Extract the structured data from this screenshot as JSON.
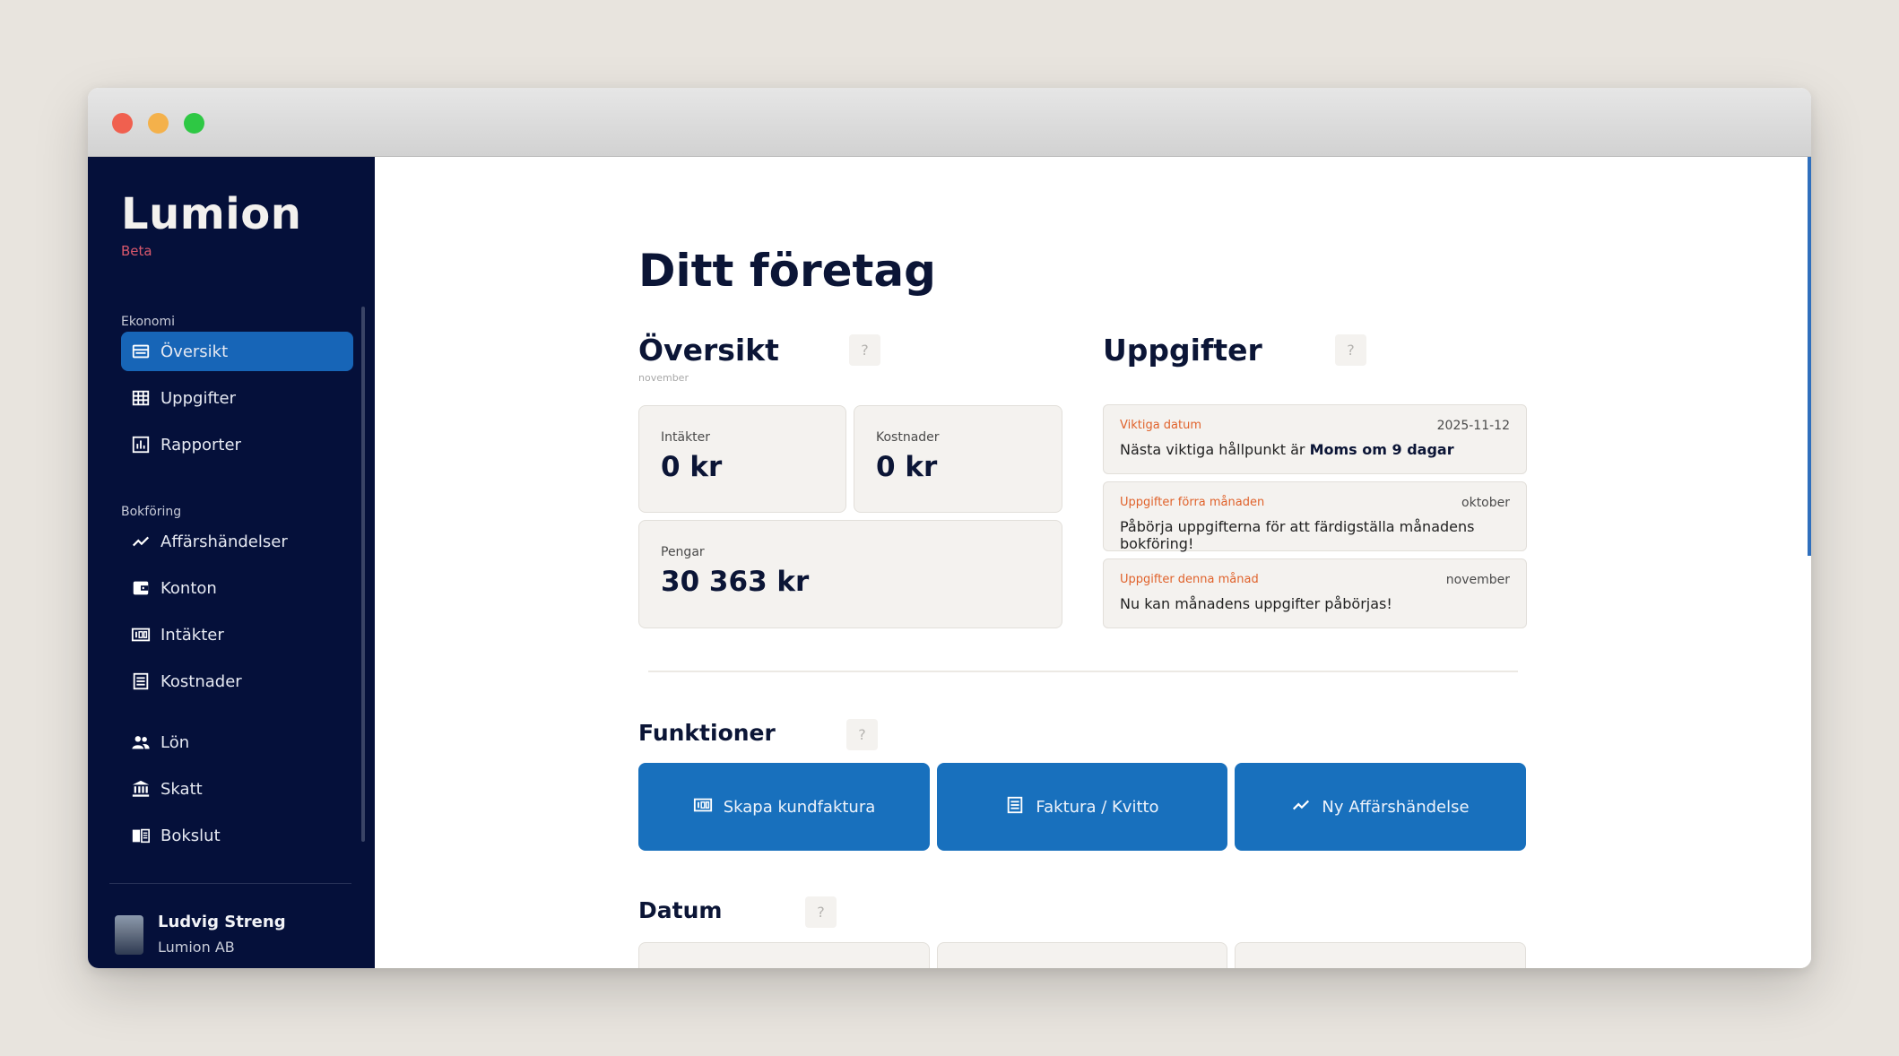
{
  "app": {
    "brand": "Lumion",
    "badge": "Beta"
  },
  "sidebar": {
    "sections": [
      {
        "label": "Ekonomi",
        "items": [
          {
            "label": "Översikt",
            "icon": "overview-icon",
            "active": true
          },
          {
            "label": "Uppgifter",
            "icon": "grid-icon",
            "active": false
          },
          {
            "label": "Rapporter",
            "icon": "report-chart-icon",
            "active": false
          }
        ]
      },
      {
        "label": "Bokföring",
        "items": [
          {
            "label": "Affärshändelser",
            "icon": "trend-icon",
            "active": false
          },
          {
            "label": "Konton",
            "icon": "wallet-icon",
            "active": false
          },
          {
            "label": "Intäkter",
            "icon": "income-icon",
            "active": false
          },
          {
            "label": "Kostnader",
            "icon": "receipt-icon",
            "active": false
          }
        ]
      },
      {
        "label": "",
        "items": [
          {
            "label": "Lön",
            "icon": "people-icon",
            "active": false
          },
          {
            "label": "Skatt",
            "icon": "bank-icon",
            "active": false
          },
          {
            "label": "Bokslut",
            "icon": "book-icon",
            "active": false
          }
        ]
      }
    ],
    "user": {
      "name": "Ludvig Streng",
      "company": "Lumion AB"
    }
  },
  "main": {
    "title": "Ditt företag",
    "overview": {
      "heading": "Översikt",
      "help": "?",
      "month": "november",
      "cards": [
        {
          "label": "Intäkter",
          "value": "0 kr"
        },
        {
          "label": "Kostnader",
          "value": "0 kr"
        },
        {
          "label": "Pengar",
          "value": "30 363 kr"
        }
      ]
    },
    "tasks": {
      "heading": "Uppgifter",
      "help": "?",
      "items": [
        {
          "title": "Viktiga datum",
          "date": "2025-11-12",
          "text_prefix": "Nästa viktiga hållpunkt är ",
          "text_bold": "Moms om 9 dagar"
        },
        {
          "title": "Uppgifter förra månaden",
          "date": "oktober",
          "text_prefix": "Påbörja uppgifterna för att färdigställa månadens bokföring!",
          "text_bold": ""
        },
        {
          "title": "Uppgifter denna månad",
          "date": "november",
          "text_prefix": "Nu kan månadens uppgifter påbörjas!",
          "text_bold": ""
        }
      ]
    },
    "functions": {
      "heading": "Funktioner",
      "help": "?",
      "buttons": [
        {
          "label": "Skapa kundfaktura",
          "icon": "invoice-icon"
        },
        {
          "label": "Faktura / Kvitto",
          "icon": "receipt-icon"
        },
        {
          "label": "Ny Affärshändelse",
          "icon": "trend-icon"
        }
      ]
    },
    "dates": {
      "heading": "Datum",
      "help": "?"
    }
  },
  "colors": {
    "sidebar_bg": "#05103a",
    "accent": "#1765b7",
    "button_bg": "#1870bd",
    "task_title": "#e0622b",
    "heading": "#0b1536"
  }
}
